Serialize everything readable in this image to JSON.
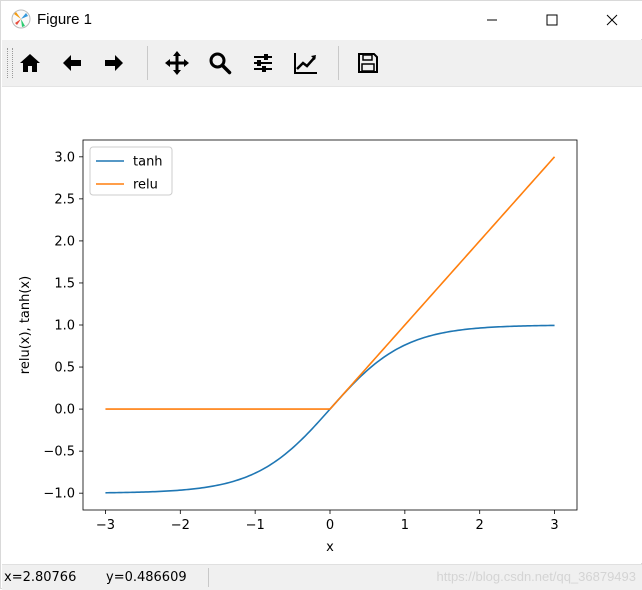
{
  "window": {
    "title": "Figure 1",
    "icon": "matplotlib-logo-icon"
  },
  "toolbar": {
    "items": [
      {
        "name": "home-icon",
        "tooltip": ""
      },
      {
        "name": "back-arrow-icon"
      },
      {
        "name": "forward-arrow-icon"
      },
      {
        "name": "pan-move-icon"
      },
      {
        "name": "zoom-magnifier-icon"
      },
      {
        "name": "configure-subplots-icon"
      },
      {
        "name": "edit-axis-icon"
      },
      {
        "name": "save-floppy-icon"
      }
    ]
  },
  "chart_data": {
    "type": "line",
    "xlabel": "x",
    "ylabel": "relu(x), tanh(x)",
    "xlim": [
      -3.3,
      3.3
    ],
    "ylim": [
      -1.2,
      3.2
    ],
    "xticks": [
      -3,
      -2,
      -1,
      0,
      1,
      2,
      3
    ],
    "xtick_labels": [
      "−3",
      "−2",
      "−1",
      "0",
      "1",
      "2",
      "3"
    ],
    "yticks": [
      -1.0,
      -0.5,
      0.0,
      0.5,
      1.0,
      1.5,
      2.0,
      2.5,
      3.0
    ],
    "ytick_labels": [
      "−1.0",
      "−0.5",
      "0.0",
      "0.5",
      "1.0",
      "1.5",
      "2.0",
      "2.5",
      "3.0"
    ],
    "grid": false,
    "legend_position": "upper-left",
    "series": [
      {
        "name": "tanh",
        "color": "#1f77b4",
        "function": "tanh",
        "x_range": [
          -3,
          3
        ]
      },
      {
        "name": "relu",
        "color": "#ff7f0e",
        "function": "relu",
        "x_range": [
          -3,
          3
        ]
      }
    ]
  },
  "statusbar": {
    "x_readout": "x=2.80766",
    "y_readout": "y=0.486609",
    "watermark": "https://blog.csdn.net/qq_36879493"
  }
}
